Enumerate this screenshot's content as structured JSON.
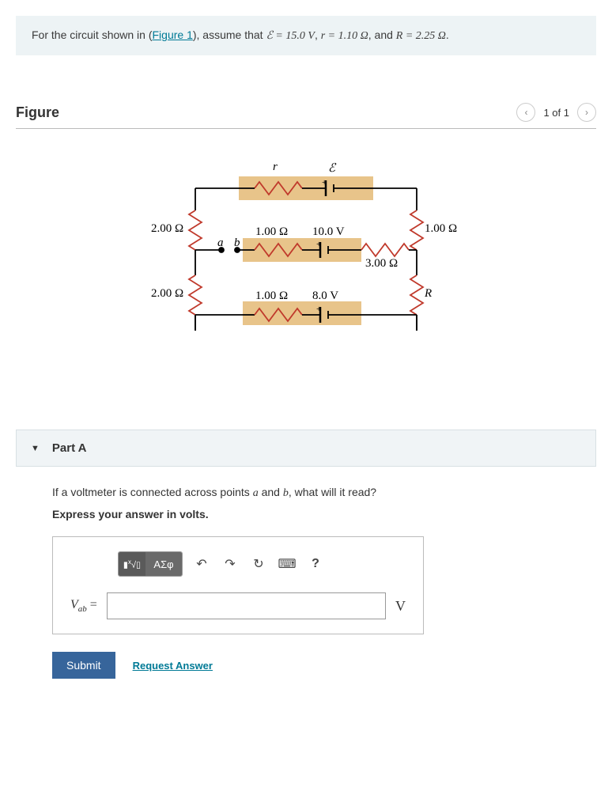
{
  "problem": {
    "prefix": "For the circuit shown in (",
    "figure_link": "Figure 1",
    "mid1": "), assume that ",
    "e_eq": "ℰ = 15.0 V",
    "mid2": ", ",
    "r_eq": "r = 1.10 Ω",
    "mid3": ", and ",
    "R_eq": "R = 2.25 Ω",
    "suffix": "."
  },
  "figure": {
    "title": "Figure",
    "pager": "1 of 1"
  },
  "circuit": {
    "r_label": "r",
    "E_label": "ℰ",
    "left_top": "2.00 Ω",
    "left_bottom": "2.00 Ω",
    "right_top": "1.00 Ω",
    "right_bottom": "R",
    "mid_r1": "1.00 Ω",
    "mid_v1": "10.0 V",
    "mid_r2": "3.00 Ω",
    "bot_r": "1.00 Ω",
    "bot_v": "8.0 V",
    "node_a": "a",
    "node_b": "b"
  },
  "part": {
    "title": "Part A",
    "question_prefix": "If a voltmeter is connected across points ",
    "question_mid": " and ",
    "question_suffix": ", what will it read?",
    "var_a": "a",
    "var_b": "b",
    "instruction": "Express your answer in volts.",
    "toolbar": {
      "greek": "ΑΣφ",
      "help": "?"
    },
    "answer_var": "V",
    "answer_sub": "ab",
    "answer_equals": " = ",
    "unit": "V",
    "submit": "Submit",
    "request": "Request Answer"
  }
}
